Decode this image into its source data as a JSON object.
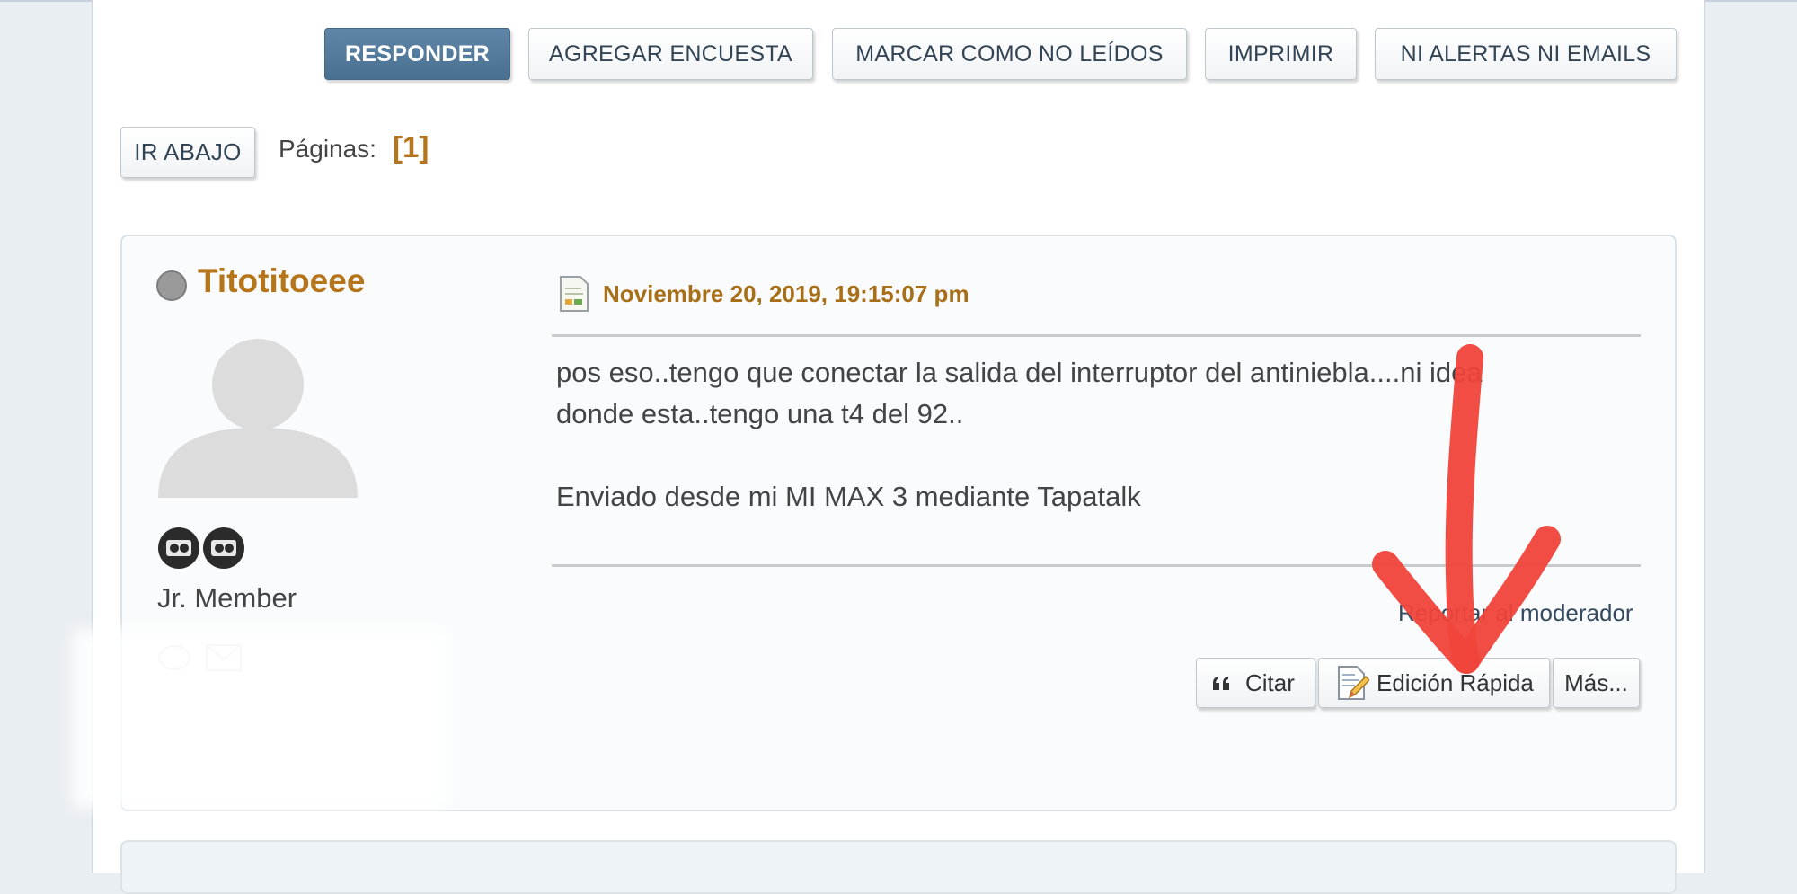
{
  "toolbar": {
    "reply": "RESPONDER",
    "add_poll": "AGREGAR ENCUESTA",
    "mark_unread": "MARCAR COMO NO LEÍDOS",
    "print": "IMPRIMIR",
    "notifications": "NI ALERTAS NI EMAILS"
  },
  "pagination": {
    "go_down": "IR ABAJO",
    "label": "Páginas:",
    "current": "[1]"
  },
  "post": {
    "username": "Titotitoeee",
    "member_title": "Jr. Member",
    "date": "Noviembre 20, 2019, 19:15:07 pm",
    "body_line1": "pos eso..tengo que conectar la salida del interruptor del antiniebla....ni idea",
    "body_line2": "donde esta..tengo una t4 del 92..",
    "signature": "Enviado desde mi MI MAX 3 mediante Tapatalk",
    "report_link": "Reportar al moderador",
    "actions": {
      "quote": "Citar",
      "quick_edit": "Edición Rápida",
      "more": "Más..."
    }
  },
  "colors": {
    "primary_button": "#4f7596",
    "username": "#b5761b",
    "annotation_arrow": "#f0433a"
  }
}
